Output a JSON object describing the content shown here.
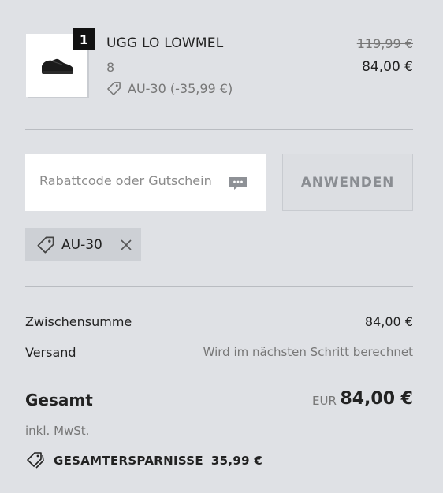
{
  "item": {
    "quantity": "1",
    "name": "UGG LO LOWMEL",
    "size": "8",
    "discount_text": "AU-30 (-35,99 €)",
    "old_price": "119,99 €",
    "price": "84,00 €"
  },
  "coupon": {
    "placeholder": "Rabattcode oder Gutschein",
    "apply_label": "ANWENDEN",
    "applied_code": "AU-30"
  },
  "summary": {
    "subtotal_label": "Zwischensumme",
    "subtotal_value": "84,00 €",
    "shipping_label": "Versand",
    "shipping_value": "Wird im nächsten Schritt berechnet",
    "total_label": "Gesamt",
    "total_currency": "EUR",
    "total_value": "84,00 €",
    "tax_note": "inkl. MwSt.",
    "savings_label": "GESAMTERSPARNISSE",
    "savings_value": "35,99 €"
  },
  "colors": {
    "background": "#dfe1e5",
    "text": "#222222",
    "muted": "#777777",
    "badge": "#111111"
  },
  "icons": [
    "tag-icon",
    "chat-icon",
    "close-icon"
  ]
}
